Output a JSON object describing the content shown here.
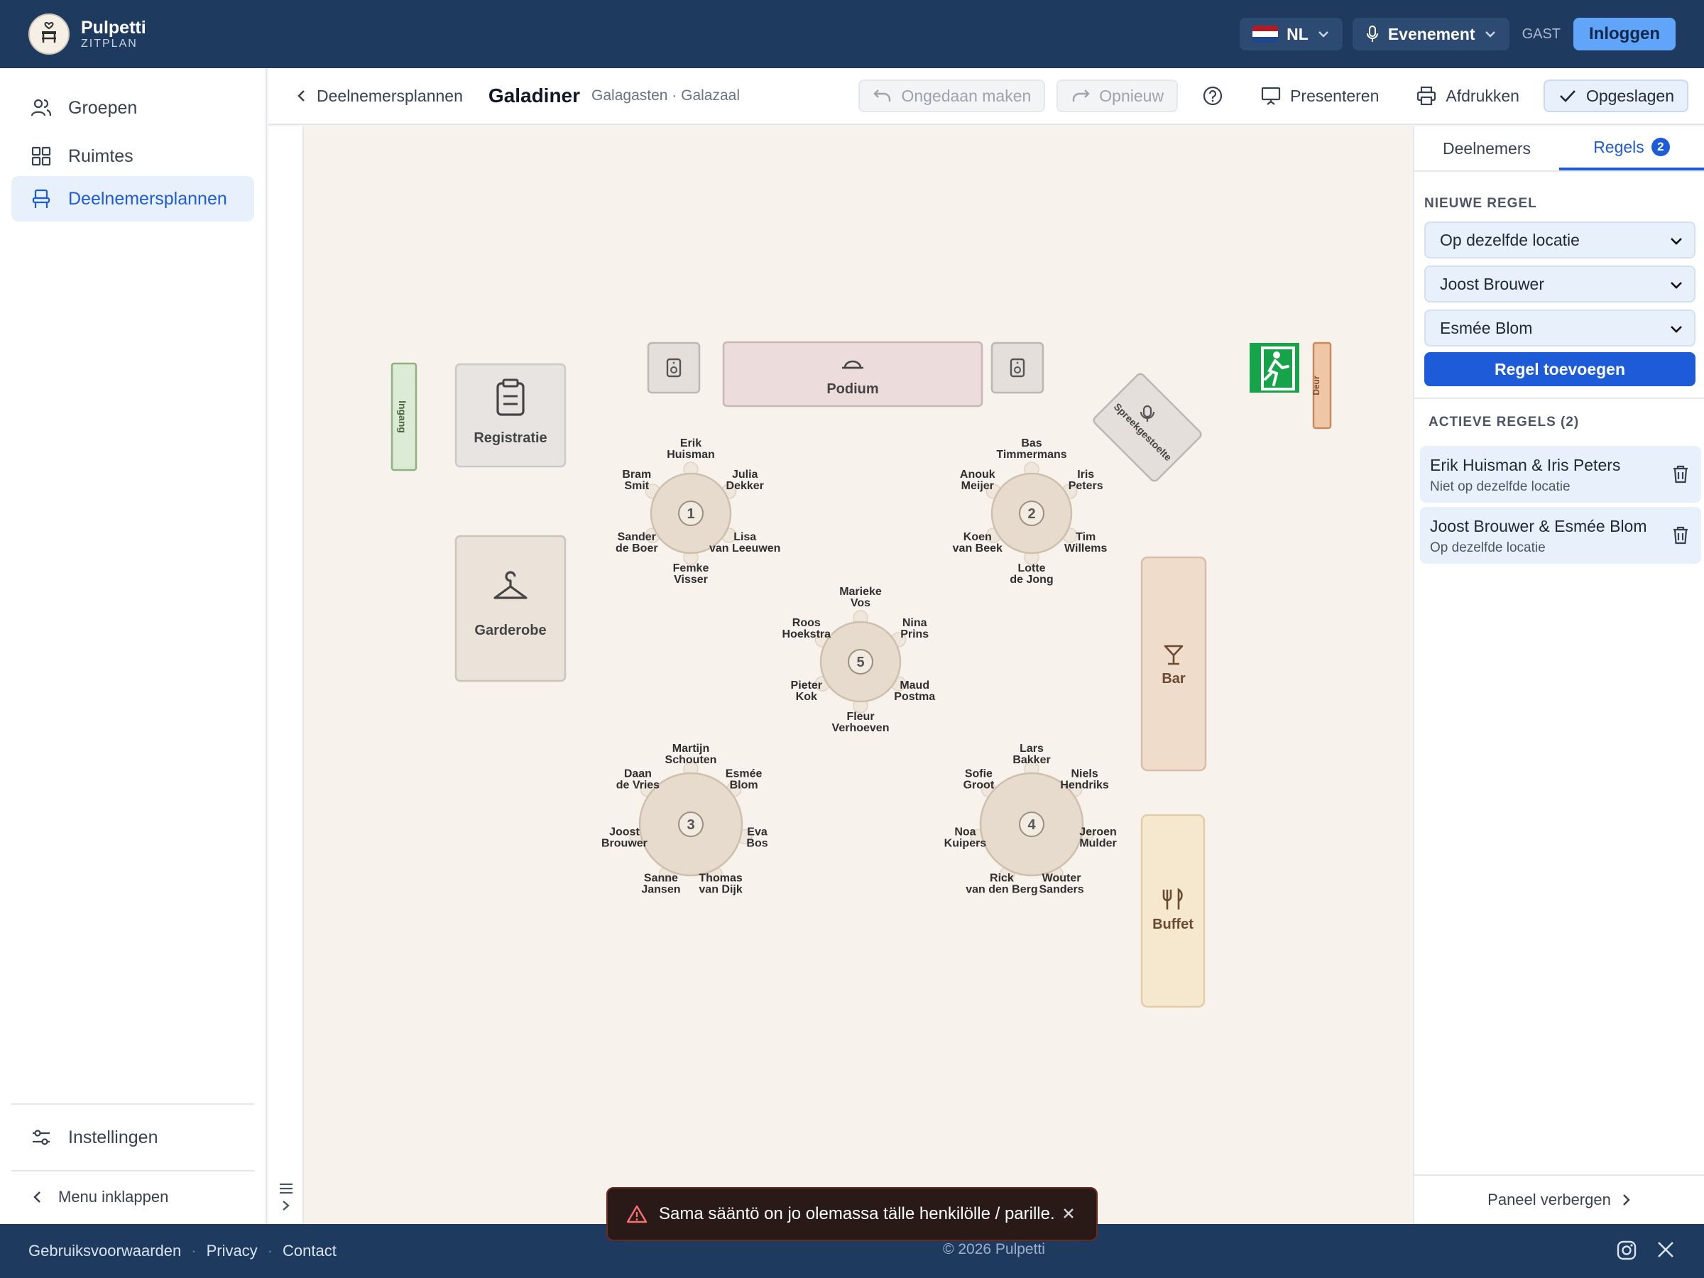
{
  "header": {
    "brand_name": "Pulpetti",
    "brand_sub": "ZITPLAN",
    "logo_text": "PULPETTI",
    "language": "NL",
    "mode": "Evenement",
    "guest_label": "GAST",
    "login_label": "Inloggen"
  },
  "sidebar": {
    "items": [
      {
        "label": "Groepen",
        "icon": "users-icon"
      },
      {
        "label": "Ruimtes",
        "icon": "grid-icon"
      },
      {
        "label": "Deelnemersplannen",
        "icon": "chair-icon"
      }
    ],
    "settings_label": "Instellingen",
    "collapse_label": "Menu inklappen"
  },
  "toolbar": {
    "back_label": "Deelnemersplannen",
    "plan_title": "Galadiner",
    "plan_subtitle": "Galagasten · Galazaal",
    "undo_label": "Ongedaan maken",
    "redo_label": "Opnieuw",
    "present_label": "Presenteren",
    "print_label": "Afdrukken",
    "saved_label": "Opgeslagen"
  },
  "floorplan": {
    "fixtures": {
      "entrance": "Ingang",
      "registration": "Registratie",
      "cloakroom": "Garderobe",
      "stage": "Podium",
      "speaker_unit": "Spreekgestoelte",
      "door": "Deur",
      "bar": "Bar",
      "buffet": "Buffet"
    },
    "tables": [
      {
        "number": "1",
        "guests": [
          [
            "Erik",
            "Huisman"
          ],
          [
            "Julia",
            "Dekker"
          ],
          [
            "Lisa",
            "van Leeuwen"
          ],
          [
            "Femke",
            "Visser"
          ],
          [
            "Sander",
            "de Boer"
          ],
          [
            "Bram",
            "Smit"
          ]
        ]
      },
      {
        "number": "2",
        "guests": [
          [
            "Bas",
            "Timmermans"
          ],
          [
            "Iris",
            "Peters"
          ],
          [
            "Tim",
            "Willems"
          ],
          [
            "Lotte",
            "de Jong"
          ],
          [
            "Koen",
            "van Beek"
          ],
          [
            "Anouk",
            "Meijer"
          ]
        ]
      },
      {
        "number": "3",
        "guests": [
          [
            "Martijn",
            "Schouten"
          ],
          [
            "Esmée",
            "Blom"
          ],
          [
            "Eva",
            "Bos"
          ],
          [
            "Thomas",
            "van Dijk"
          ],
          [
            "Sanne",
            "Jansen"
          ],
          [
            "Joost",
            "Brouwer"
          ],
          [
            "Daan",
            "de Vries"
          ]
        ]
      },
      {
        "number": "4",
        "guests": [
          [
            "Lars",
            "Bakker"
          ],
          [
            "Niels",
            "Hendriks"
          ],
          [
            "Jeroen",
            "Mulder"
          ],
          [
            "Wouter",
            "Sanders"
          ],
          [
            "Rick",
            "van den Berg"
          ],
          [
            "Noa",
            "Kuipers"
          ],
          [
            "Sofie",
            "Groot"
          ]
        ]
      },
      {
        "number": "5",
        "guests": [
          [
            "Marieke",
            "Vos"
          ],
          [
            "Nina",
            "Prins"
          ],
          [
            "Maud",
            "Postma"
          ],
          [
            "Fleur",
            "Verhoeven"
          ],
          [
            "Pieter",
            "Kok"
          ],
          [
            "Roos",
            "Hoekstra"
          ]
        ]
      }
    ]
  },
  "panel": {
    "tabs": [
      {
        "label": "Deelnemers"
      },
      {
        "label": "Regels",
        "badge": "2"
      }
    ],
    "new_rule_title": "NIEUWE REGEL",
    "rule_type_value": "Op dezelfde locatie",
    "person_a_value": "Joost Brouwer",
    "person_b_value": "Esmée Blom",
    "add_rule_label": "Regel toevoegen",
    "active_rules_title": "ACTIEVE REGELS (2)",
    "rules": [
      {
        "names": "Erik Huisman & Iris Peters",
        "type": "Niet op dezelfde locatie"
      },
      {
        "names": "Joost Brouwer & Esmée Blom",
        "type": "Op dezelfde locatie"
      }
    ],
    "hide_label": "Paneel verbergen"
  },
  "toast": {
    "message": "Sama sääntö on jo olemassa tälle henkilölle / parille."
  },
  "footer": {
    "links": [
      "Gebruiksvoorwaarden",
      "Privacy",
      "Contact"
    ],
    "copyright": "© 2026 Pulpetti"
  },
  "colors": {
    "header_bg": "#1e3a5f",
    "accent": "#1d5bd8",
    "canvas_bg": "#f8f2ec",
    "exit_green": "#16a34a"
  }
}
